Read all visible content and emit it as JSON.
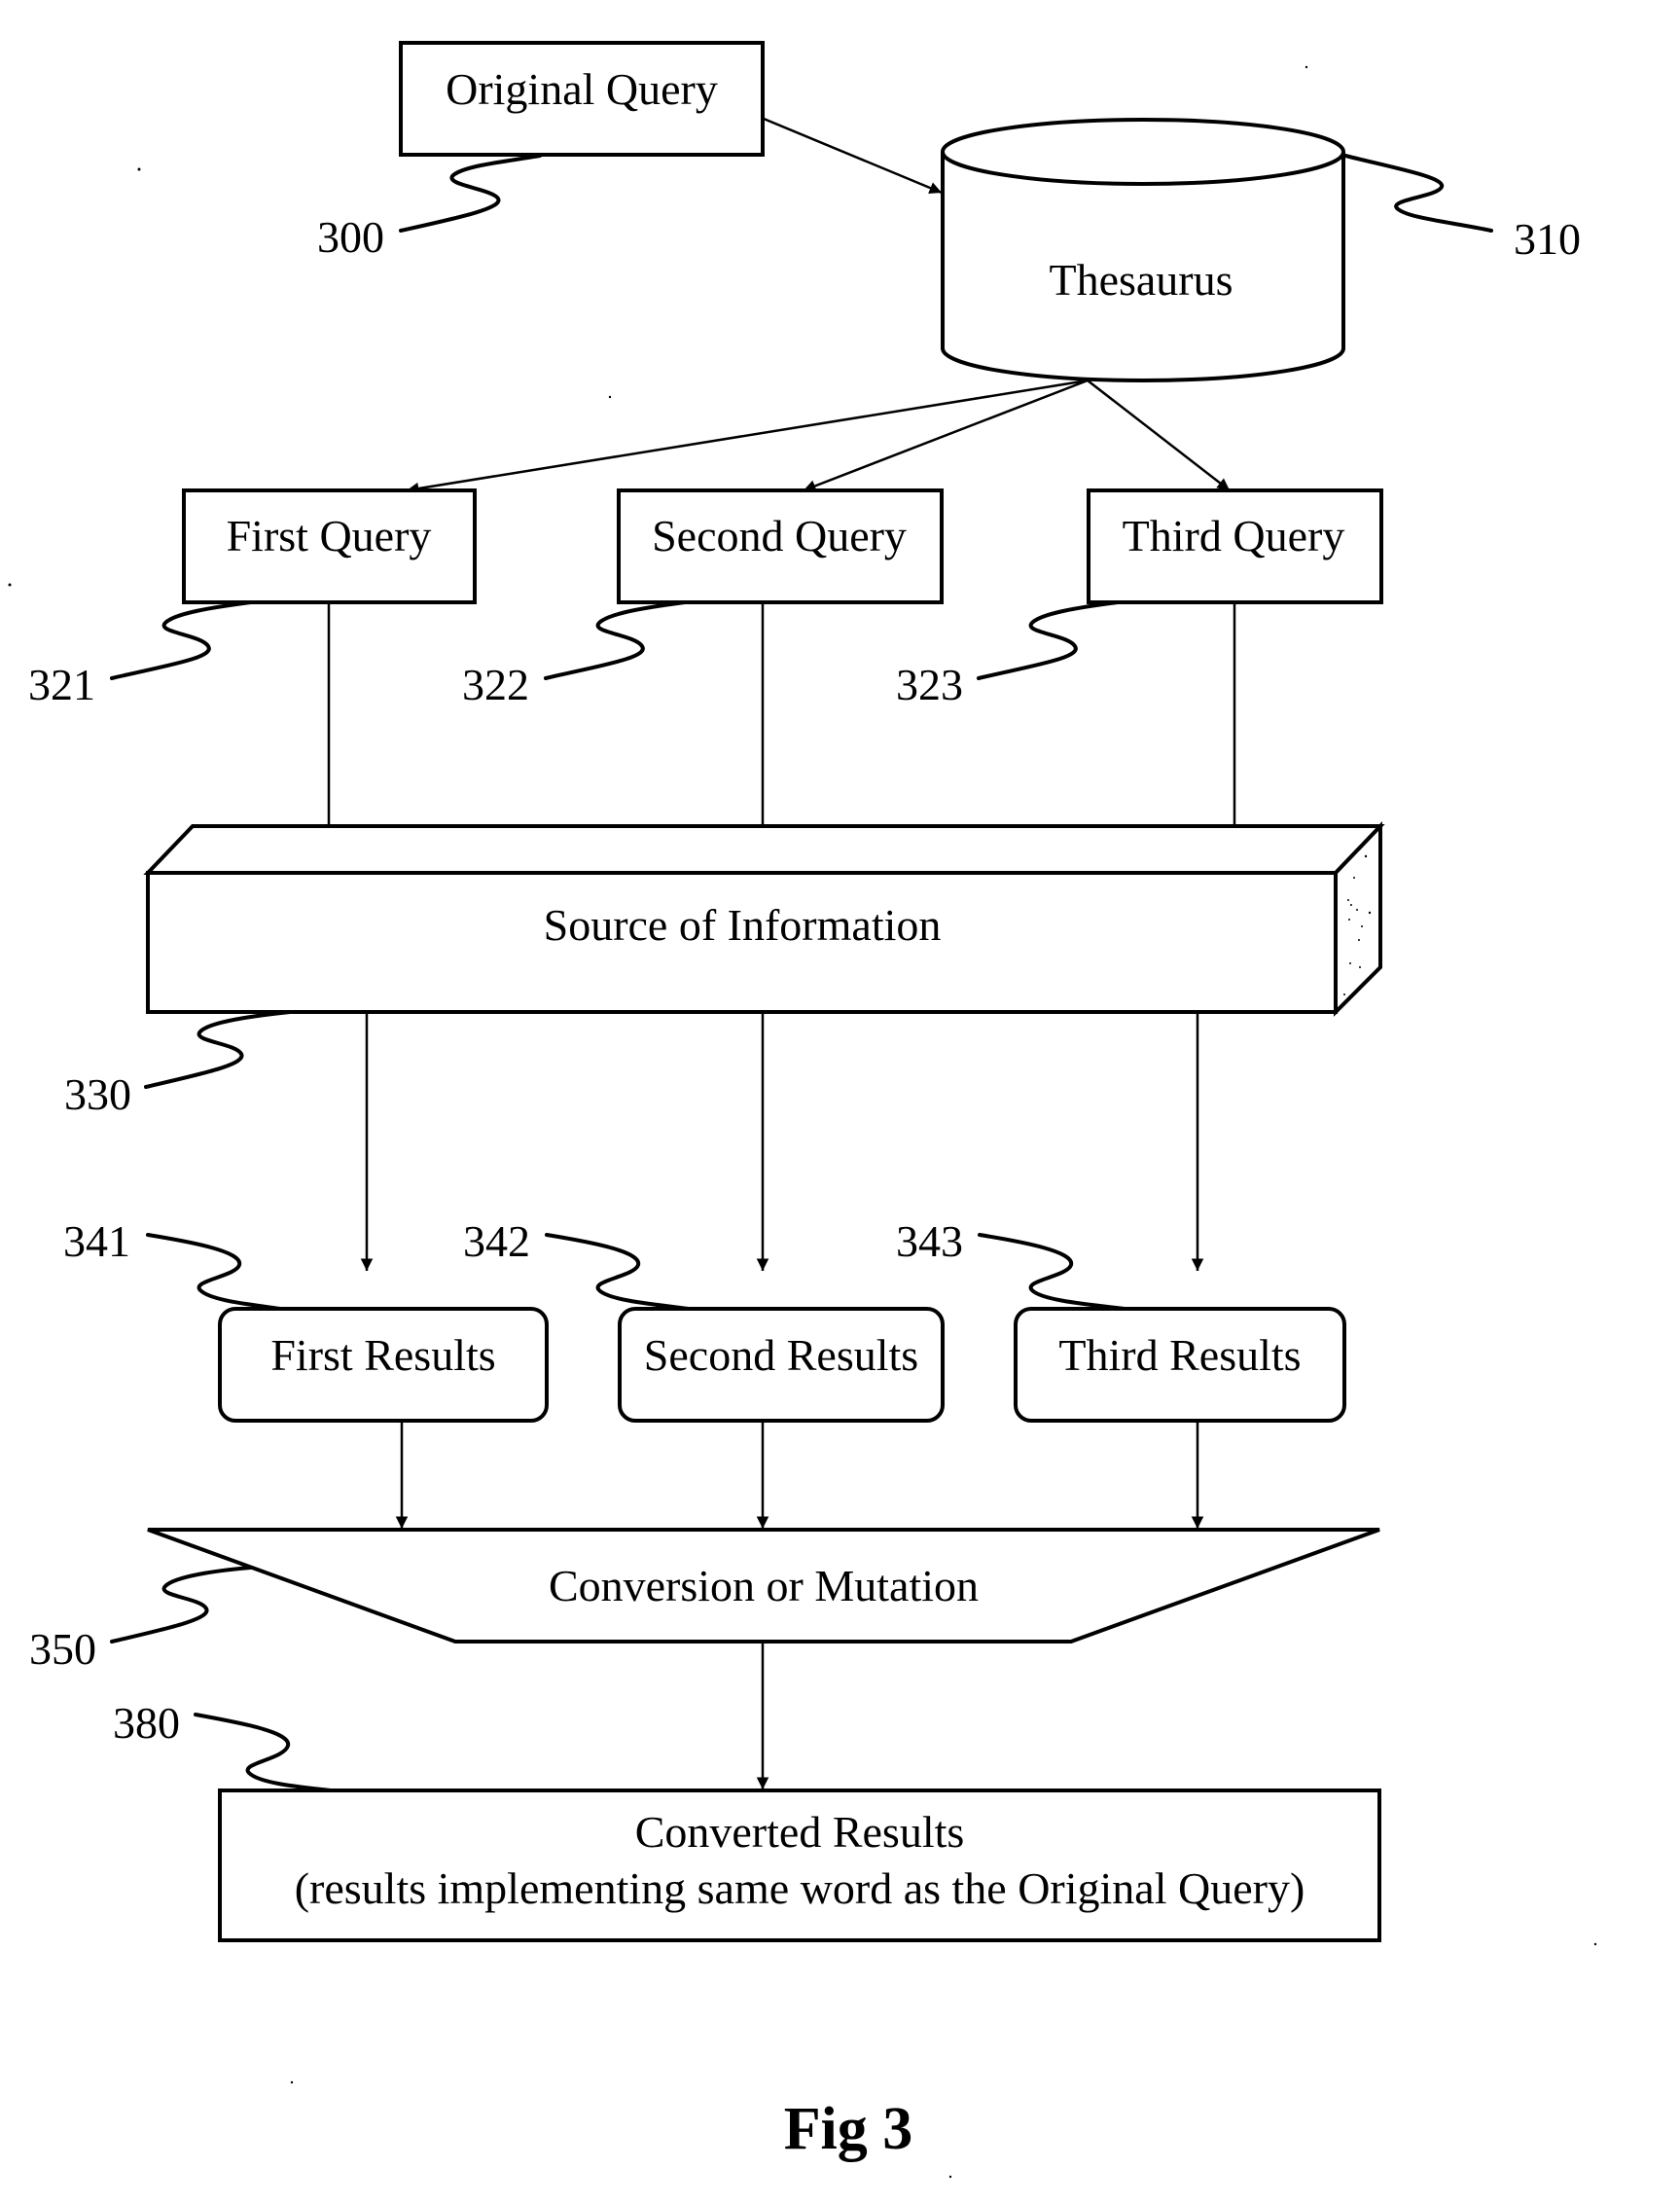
{
  "figure": {
    "caption": "Fig 3"
  },
  "nodes": {
    "original_query": {
      "label": "Original Query",
      "ref": "300"
    },
    "thesaurus": {
      "label": "Thesaurus",
      "ref": "310"
    },
    "first_query": {
      "label": "First Query",
      "ref": "321"
    },
    "second_query": {
      "label": "Second Query",
      "ref": "322"
    },
    "third_query": {
      "label": "Third Query",
      "ref": "323"
    },
    "source": {
      "label": "Source of Information",
      "ref": "330"
    },
    "first_results": {
      "label": "First Results",
      "ref": "341"
    },
    "second_results": {
      "label": "Second Results",
      "ref": "342"
    },
    "third_results": {
      "label": "Third Results",
      "ref": "343"
    },
    "conversion": {
      "label": "Conversion or Mutation",
      "ref": "350"
    },
    "converted": {
      "label": "Converted Results",
      "sublabel": "(results implementing same word as the Original Query)",
      "ref": "380"
    }
  },
  "edges": [
    {
      "from": "original_query",
      "to": "thesaurus"
    },
    {
      "from": "thesaurus",
      "to": "first_query"
    },
    {
      "from": "thesaurus",
      "to": "second_query"
    },
    {
      "from": "thesaurus",
      "to": "third_query"
    },
    {
      "from": "first_query",
      "to": "source"
    },
    {
      "from": "second_query",
      "to": "source"
    },
    {
      "from": "third_query",
      "to": "source"
    },
    {
      "from": "source",
      "to": "first_results"
    },
    {
      "from": "source",
      "to": "second_results"
    },
    {
      "from": "source",
      "to": "third_results"
    },
    {
      "from": "first_results",
      "to": "conversion"
    },
    {
      "from": "second_results",
      "to": "conversion"
    },
    {
      "from": "third_results",
      "to": "conversion"
    },
    {
      "from": "conversion",
      "to": "converted"
    }
  ]
}
